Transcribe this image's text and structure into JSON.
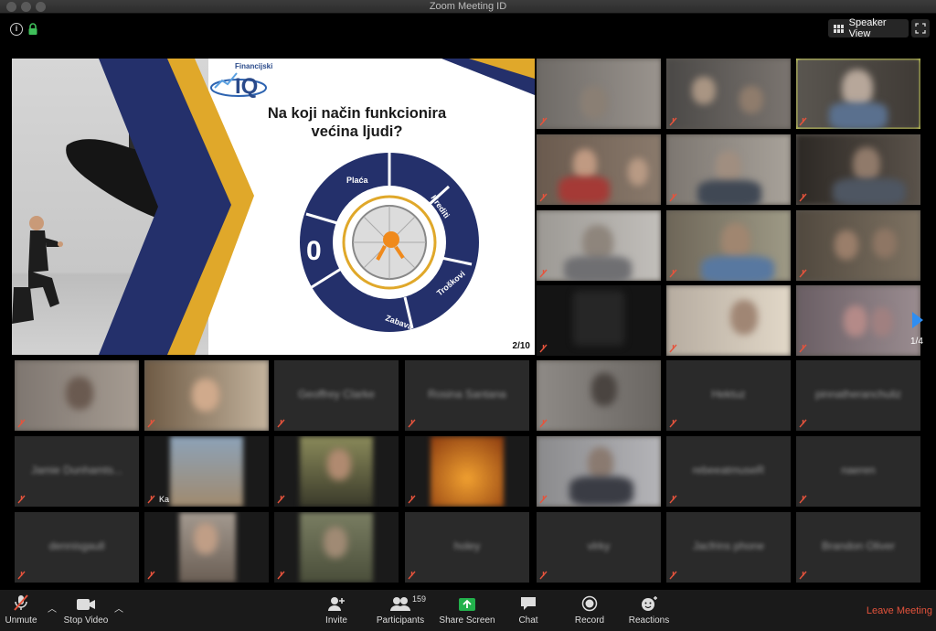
{
  "window": {
    "title": "Zoom Meeting ID"
  },
  "topbar": {
    "speaker_view_label": "Speaker View"
  },
  "slide": {
    "logo_text": "Financijski",
    "title_line1": "Na koji način funkcionira",
    "title_line2": "većina ljudi?",
    "page": "2/10",
    "wheel": [
      "Plaća",
      "Krediti",
      "Troškovi",
      "Zabava",
      "0"
    ]
  },
  "gallery": {
    "page_indicator": "1/4",
    "tile_names": [
      "Geoffrey Clarke",
      "Rosina Santana",
      "Hektuz",
      "pinnatheranchuliz",
      "Jamie Dunhamts...",
      "Ka",
      "rebeeatmuseR",
      "naeren",
      "dennisgaull",
      "holey",
      "vlrky",
      "Jacfrins phone",
      "Brandon Oliver"
    ]
  },
  "toolbar": {
    "unmute": "Unmute",
    "stop_video": "Stop Video",
    "invite": "Invite",
    "participants": "Participants",
    "participants_count": "159",
    "share_screen": "Share Screen",
    "chat": "Chat",
    "record": "Record",
    "reactions": "Reactions",
    "leave": "Leave Meeting"
  },
  "colors": {
    "active_speaker": "#e8f062",
    "share_green": "#22b14c",
    "leave_red": "#e5533c",
    "slide_navy": "#24306b",
    "slide_gold": "#e0a82a"
  },
  "icons": [
    "info-icon",
    "lock-icon",
    "grid-icon",
    "fullscreen-icon",
    "muted-mic-icon",
    "video-camera-icon",
    "invite-icon",
    "participants-icon",
    "share-screen-icon",
    "chat-icon",
    "record-icon",
    "reactions-icon",
    "next-page-arrow-icon"
  ]
}
